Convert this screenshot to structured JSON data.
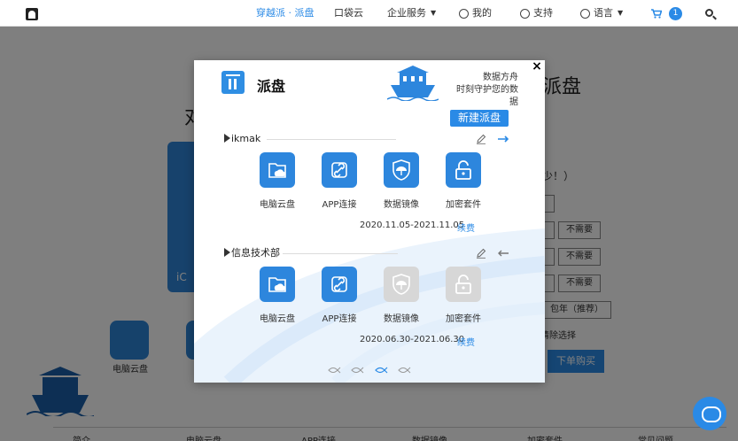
{
  "nav": {
    "items": [
      {
        "label": "穿越派 · 派盘",
        "active": true
      },
      {
        "label": "口袋云"
      },
      {
        "label": "企业服务"
      },
      {
        "label": "我的"
      },
      {
        "label": "支持"
      },
      {
        "label": "语言"
      }
    ],
    "cart_count": "1",
    "icons": [
      "logo-icon",
      "user-icon",
      "help-icon",
      "globe-icon",
      "cart-icon",
      "search-icon"
    ]
  },
  "background": {
    "title_right": "派盘",
    "title_left": "对",
    "hint": "少！）",
    "option_not_needed": "不需要",
    "plan_option": "包年（推荐）",
    "clear_selection": "清除选择",
    "buy_button": "下单购买",
    "app_label": "电脑云盘",
    "bottom_tabs": [
      "简介",
      "电脑云盘",
      "APP连接",
      "数据镜像",
      "加密套件",
      "常见问题"
    ]
  },
  "modal": {
    "brand_title": "派盘",
    "slogan_line1": "数据方舟",
    "slogan_line2": "时刻守护您的数据",
    "new_button": "新建派盘",
    "close_label": "×",
    "sections": [
      {
        "name": "ikmak",
        "tiles": [
          {
            "label": "电脑云盘",
            "enabled": true,
            "icon": "folder-cloud-icon"
          },
          {
            "label": "APP连接",
            "enabled": true,
            "icon": "link-icon"
          },
          {
            "label": "数据镜像",
            "enabled": true,
            "icon": "umbrella-shield-icon"
          },
          {
            "label": "加密套件",
            "enabled": true,
            "icon": "padlock-icon"
          }
        ],
        "dates": "2020.11.05-2021.11.05",
        "renew": "续费"
      },
      {
        "name": "信息技术部",
        "tiles": [
          {
            "label": "电脑云盘",
            "enabled": true,
            "icon": "folder-cloud-icon"
          },
          {
            "label": "APP连接",
            "enabled": true,
            "icon": "link-icon"
          },
          {
            "label": "数据镜像",
            "enabled": false,
            "icon": "umbrella-shield-icon"
          },
          {
            "label": "加密套件",
            "enabled": false,
            "icon": "padlock-icon"
          }
        ],
        "dates": "2020.06.30-2021.06.30",
        "renew": "续费"
      }
    ],
    "pager_count": 4,
    "pager_active": 3
  },
  "colors": {
    "accent": "#2a8ae6",
    "tile_on": "#2d86dd",
    "tile_off": "#d7d7d7"
  }
}
